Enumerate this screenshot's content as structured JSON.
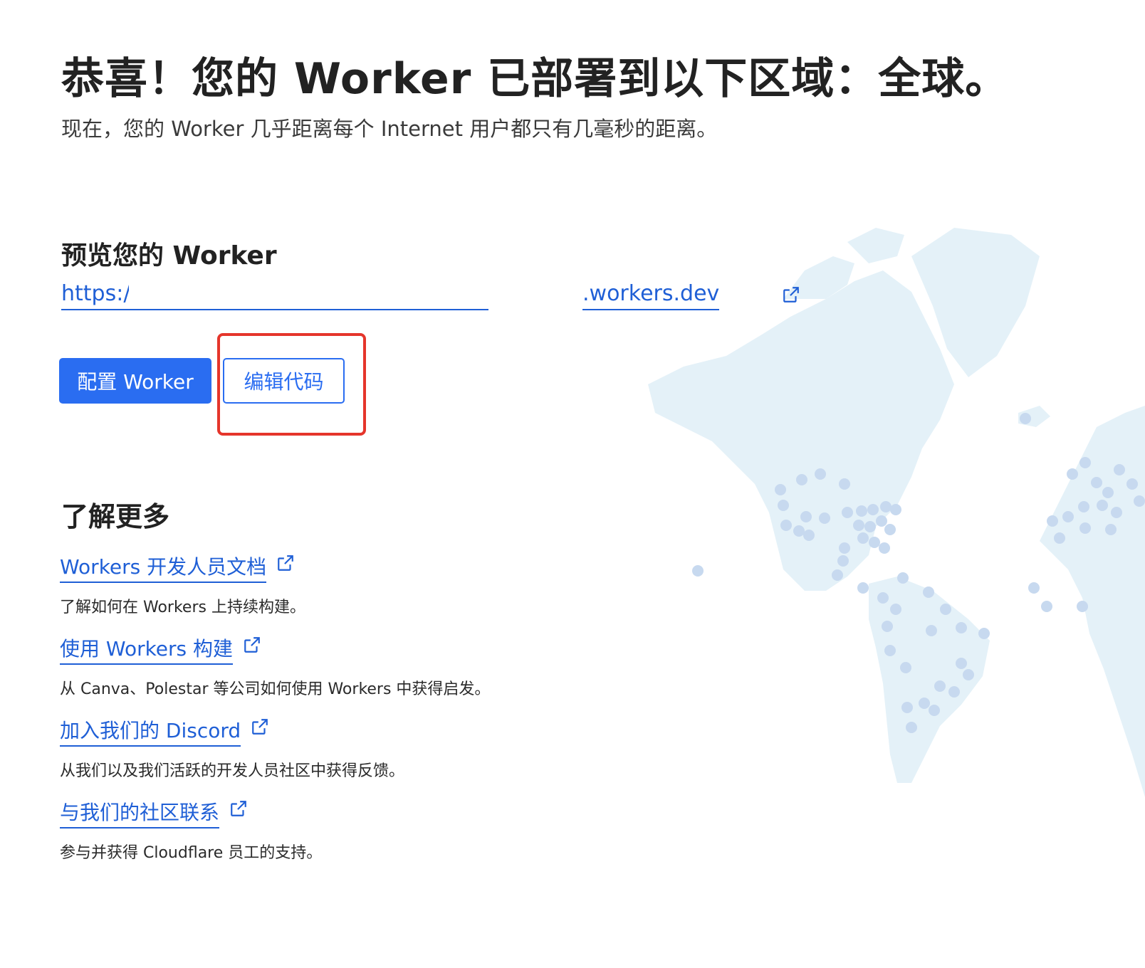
{
  "header": {
    "title": "恭喜！您的 Worker 已部署到以下区域：全球。",
    "subtitle": "现在，您的 Worker 几乎距离每个 Internet 用户都只有几毫秒的距离。"
  },
  "preview": {
    "heading": "预览您的 Worker",
    "url_prefix": "https://",
    "url_suffix": ".workers.dev"
  },
  "actions": {
    "configure_label": "配置 Worker",
    "edit_code_label": "编辑代码"
  },
  "learn_more": {
    "heading": "了解更多",
    "items": [
      {
        "label": "Workers 开发人员文档",
        "description": "了解如何在 Workers 上持续构建。"
      },
      {
        "label": "使用 Workers 构建",
        "description": "从 Canva、Polestar 等公司如何使用 Workers 中获得启发。"
      },
      {
        "label": "加入我们的 Discord",
        "description": "从我们以及我们活跃的开发人员社区中获得反馈。"
      },
      {
        "label": "与我们的社区联系",
        "description": "参与并获得 Cloudflare 员工的支持。"
      }
    ]
  },
  "colors": {
    "primary": "#2a6df1",
    "link": "#1f5fd6",
    "highlight": "#e5352b",
    "map_land": "#e4f1f8",
    "map_dot": "#c7d9ef"
  }
}
